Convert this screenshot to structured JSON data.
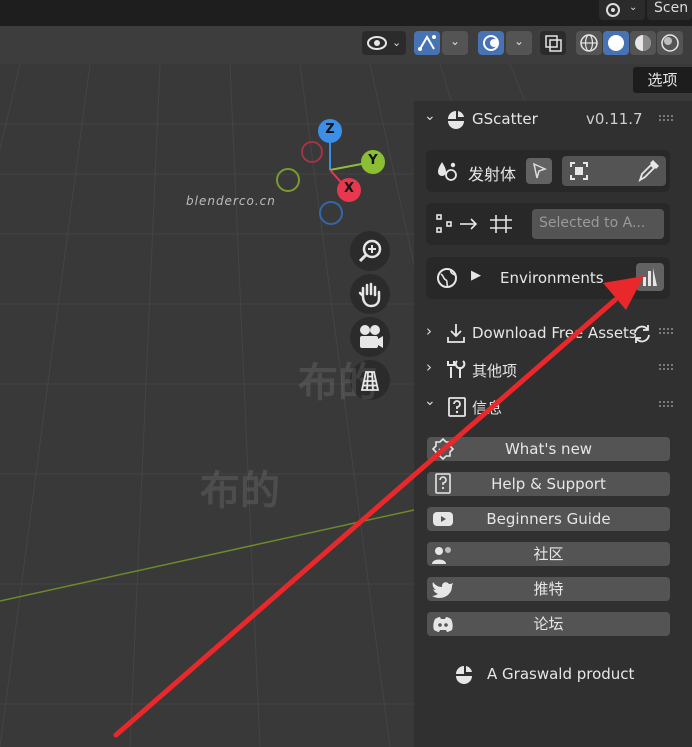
{
  "topbar": {
    "scene_label": "Scen"
  },
  "sidebar_tab": {
    "label": "选项"
  },
  "watermark": {
    "text": "blenderco.cn",
    "big_text": "布的"
  },
  "gizmo": {
    "x": "X",
    "y": "Y",
    "z": "Z"
  },
  "gscatter": {
    "title": "GScatter",
    "version": "v0.11.7",
    "emitter_label": "发射体",
    "selected_to_active": "Selected to A...",
    "environments_label": "Environments"
  },
  "sections": {
    "download": "Download Free Assets",
    "other": "其他项",
    "info": "信息"
  },
  "info_buttons": [
    {
      "label": "What's new",
      "icon": "badge-check-icon"
    },
    {
      "label": "Help & Support",
      "icon": "help-book-icon"
    },
    {
      "label": "Beginners Guide",
      "icon": "youtube-icon"
    },
    {
      "label": "社区",
      "icon": "community-icon"
    },
    {
      "label": "推特",
      "icon": "twitter-icon"
    },
    {
      "label": "论坛",
      "icon": "discord-icon"
    }
  ],
  "footer": {
    "text": "A Graswald product"
  },
  "colors": {
    "accent_blue": "#4772b3",
    "annotation_red": "#e8282b",
    "axis_x": "#e8384f",
    "axis_y": "#8bbf33",
    "axis_z": "#3b8fe8"
  }
}
